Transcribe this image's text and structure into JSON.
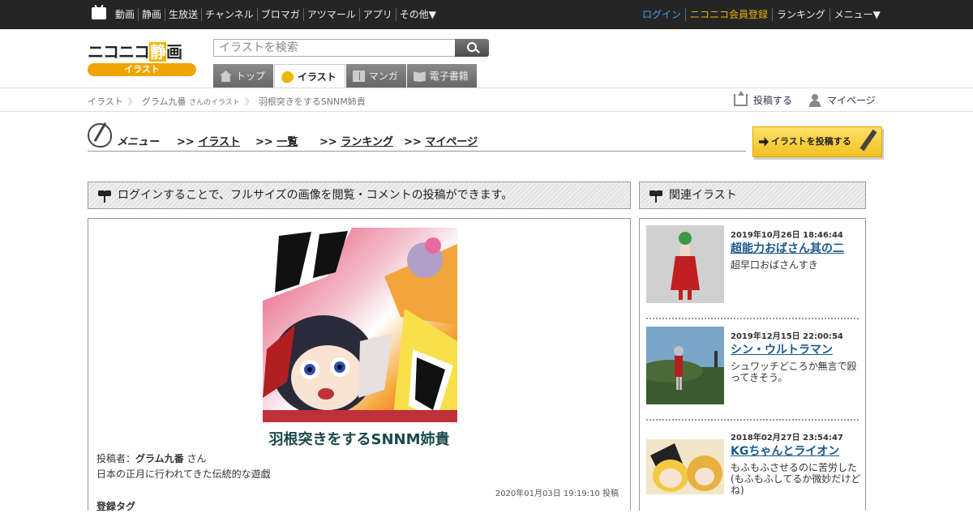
{
  "topbar": {
    "left_items": [
      "動画",
      "静画",
      "生放送",
      "チャンネル",
      "ブロマガ",
      "アツマール",
      "アプリ",
      "その他▼"
    ],
    "login": "ログイン",
    "register": "ニコニコ会員登録",
    "ranking": "ランキング",
    "menu": "メニュー▼",
    "login_color": "#3ca2ff",
    "register_color": "#f0b400"
  },
  "logo": {
    "main_a": "ニコニコ",
    "main_b": "静",
    "main_c": "画",
    "sub": "イラスト"
  },
  "search": {
    "placeholder": "イラストを検索"
  },
  "tabs": [
    "トップ",
    "イラスト",
    "マンガ",
    "電子書籍"
  ],
  "breadcrumb": {
    "root": "イラスト",
    "user": "グラム九番",
    "user_suffix": "さんのイラスト",
    "current": "羽根突きをするSNNM姉貴"
  },
  "actions": {
    "post": "投稿する",
    "mypage": "マイページ"
  },
  "menu": {
    "title": "メニュー",
    "links": [
      {
        "prefix": ">>",
        "label": "イラスト"
      },
      {
        "prefix": ">>",
        "label": "一覧"
      },
      {
        "prefix": ">>",
        "label": "ランキング"
      },
      {
        "prefix": ">>",
        "label": "マイページ"
      }
    ],
    "post_button": "イラストを投稿する"
  },
  "main": {
    "notice": "ログインすることで、フルサイズの画像を閲覧・コメントの投稿ができます。",
    "title": "羽根突きをするSNNM姉貴",
    "poster_label": "投稿者：",
    "poster_name": "グラム九番",
    "poster_suffix": "さん",
    "description": "日本の正月に行われてきた伝統的な遊戯",
    "posted_at": "2020年01月03日 19:19:10 投稿",
    "tags_heading": "登録タグ"
  },
  "related": {
    "heading": "関連イラスト",
    "items": [
      {
        "date": "2019年10月26日 18:46:44",
        "title": "超能力おばさん其の二",
        "caption": "超早口おばさんすき"
      },
      {
        "date": "2019年12月15日 22:00:54",
        "title": "シン・ウルトラマン",
        "caption": "シュワッチどころか無言で殴ってきそう。"
      },
      {
        "date": "2018年02月27日 23:54:47",
        "title": "KGちゃんとライオン",
        "caption": "もふもふさせるのに苦労した(もふもふしてるか微妙だけどね)"
      }
    ]
  }
}
